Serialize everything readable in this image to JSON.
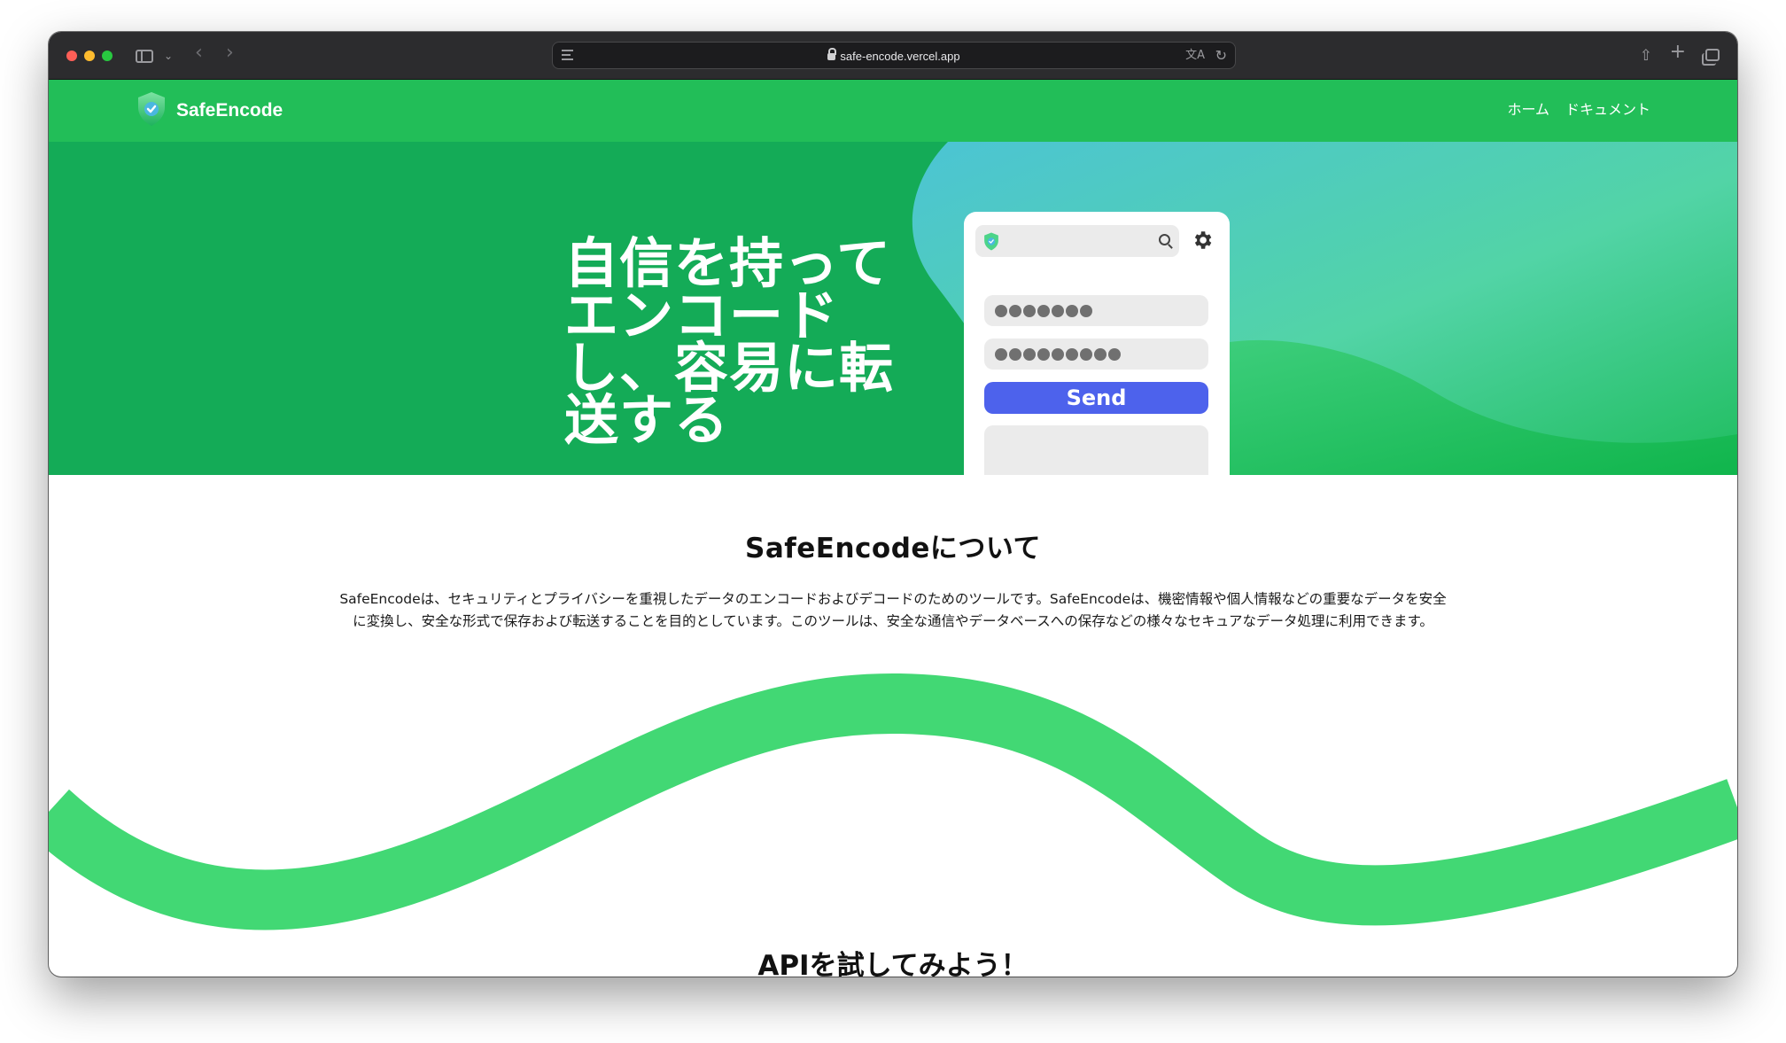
{
  "browser": {
    "url": "safe-encode.vercel.app"
  },
  "navbar": {
    "brand": "SafeEncode",
    "links": [
      {
        "label": "ホーム"
      },
      {
        "label": "ドキュメント"
      }
    ]
  },
  "hero": {
    "title_lines": [
      "自信を持って",
      "エンコード",
      "し、容易に転",
      "送する"
    ],
    "mockup": {
      "send_label": "Send",
      "field_1_masked_count": 7,
      "field_2_masked_count": 9
    }
  },
  "about": {
    "title": "SafeEncodeについて",
    "text_line_1": "SafeEncodeは、セキュリティとプライバシーを重視したデータのエンコードおよびデコードのためのツールです。SafeEncodeは、機密情報や個人情報などの重要なデータを安全",
    "text_line_2": "に変換し、安全な形式で保存および転送することを目的としています。このツールは、安全な通信やデータベースへの保存などの様々なセキュアなデータ処理に利用できます。"
  },
  "api_section": {
    "title": "APIを試してみよう！"
  },
  "colors": {
    "navbar": "#22be58",
    "hero_bg": "#14ab57",
    "wave": "#42d874",
    "send_button": "#4d62ec"
  }
}
